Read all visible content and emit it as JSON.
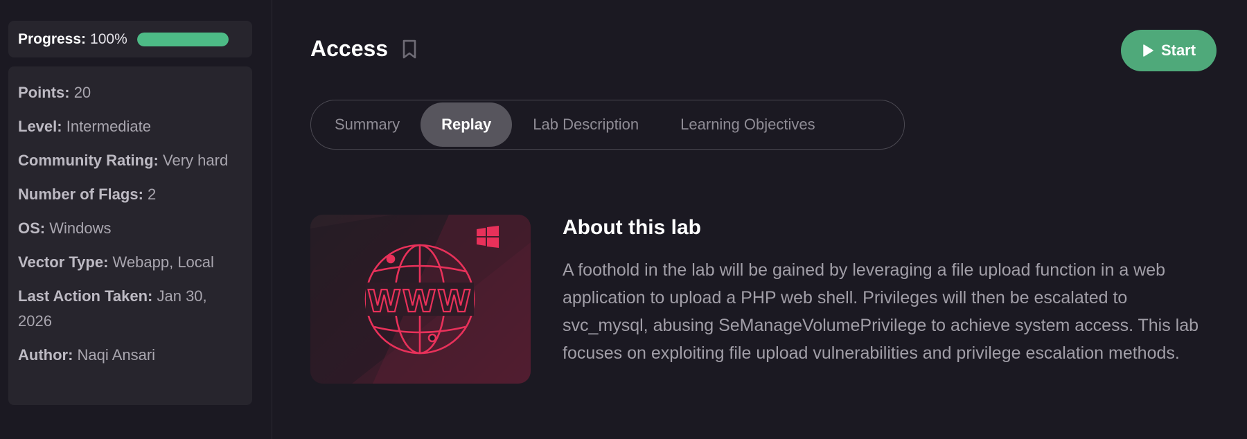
{
  "progress": {
    "label": "Progress:",
    "value_text": "100%",
    "fraction": 1.0,
    "color": "#4dbb86"
  },
  "info": [
    {
      "key": "Points:",
      "value": "20"
    },
    {
      "key": "Level:",
      "value": "Intermediate"
    },
    {
      "key": "Community Rating:",
      "value": "Very hard"
    },
    {
      "key": "Number of Flags:",
      "value": "2"
    },
    {
      "key": "OS:",
      "value": "Windows"
    },
    {
      "key": "Vector Type:",
      "value": "Webapp, Local"
    },
    {
      "key": "Last Action Taken:",
      "value": "Jan 30, 2026"
    },
    {
      "key": "Author:",
      "value": "Naqi Ansari"
    }
  ],
  "header": {
    "title": "Access",
    "bookmark_icon": "bookmark-icon",
    "start_label": "Start",
    "start_icon": "play-icon",
    "accent": "#4fa97a"
  },
  "tabs": [
    {
      "label": "Summary",
      "active": false
    },
    {
      "label": "Replay",
      "active": true
    },
    {
      "label": "Lab Description",
      "active": false
    },
    {
      "label": "Learning Objectives",
      "active": false
    }
  ],
  "lab_image": {
    "icons": [
      "globe-www-icon",
      "windows-logo-icon"
    ],
    "globe_text": "WWW",
    "accent": "#e8315a"
  },
  "about": {
    "title": "About this lab",
    "text": "A foothold in the lab will be gained by leveraging a file upload function in a web application to upload a PHP web shell. Privileges will then be escalated to svc_mysql, abusing SeManageVolumePrivilege to achieve system access. This lab focuses on exploiting file upload vulnerabilities and privilege escalation methods."
  }
}
